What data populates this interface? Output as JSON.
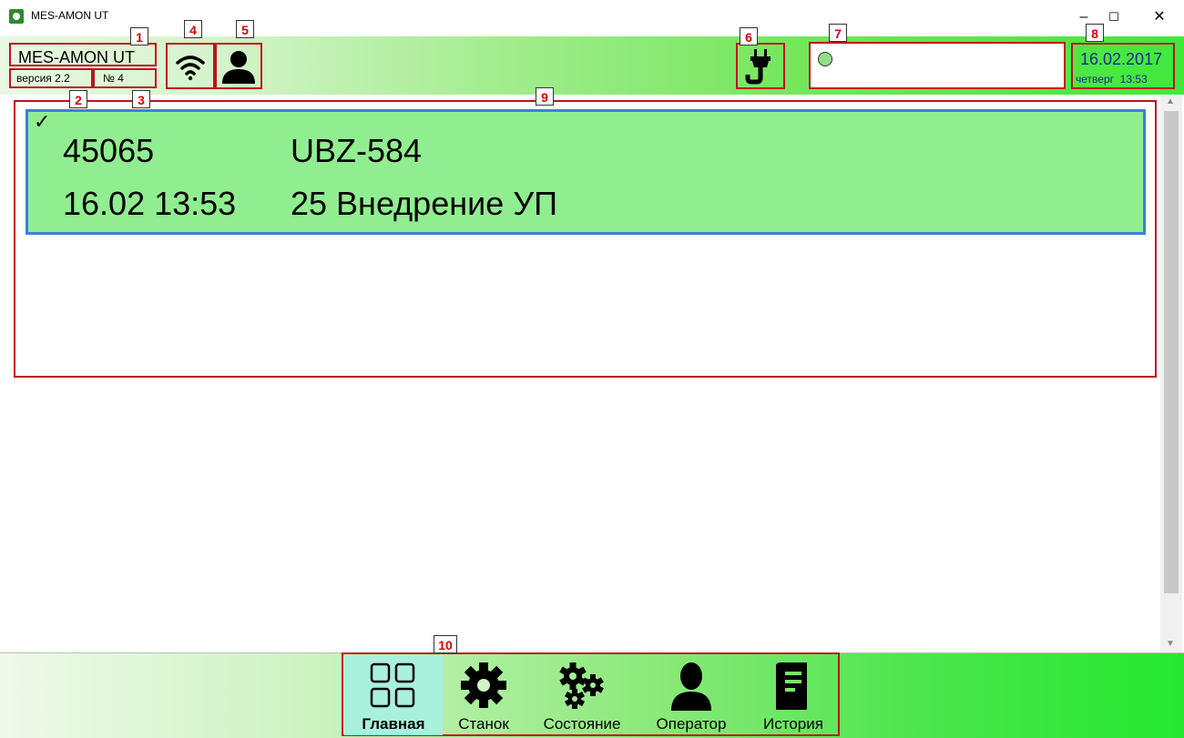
{
  "window": {
    "title": "MES-AMON UT",
    "controls": {
      "minimize": "–",
      "maximize": "☐",
      "close": "✕"
    }
  },
  "header": {
    "app_name": "MES-AMON UT",
    "version": "версия 2.2",
    "number": "№ 4",
    "date": "16.02.2017",
    "weekday": "четверг",
    "time": "13:53",
    "status_indicator_color": "#8fe088"
  },
  "callouts": [
    "1",
    "2",
    "3",
    "4",
    "5",
    "6",
    "7",
    "8",
    "9",
    "10"
  ],
  "task": {
    "order": "45065",
    "code": "UBZ-584",
    "datetime": "16.02 13:53",
    "operation": "25 Внедрение УП",
    "checkmark": "✓"
  },
  "nav": {
    "items": [
      {
        "label": "Главная",
        "icon": "grid-icon",
        "active": true
      },
      {
        "label": "Станок",
        "icon": "gear-icon",
        "active": false
      },
      {
        "label": "Состояние",
        "icon": "gears-icon",
        "active": false
      },
      {
        "label": "Оператор",
        "icon": "person-icon",
        "active": false
      },
      {
        "label": "История",
        "icon": "book-icon",
        "active": false
      }
    ]
  },
  "colors": {
    "accent_green": "#90ee90",
    "highlight_border": "#3a7fe0",
    "callout_red": "#c0121a"
  }
}
